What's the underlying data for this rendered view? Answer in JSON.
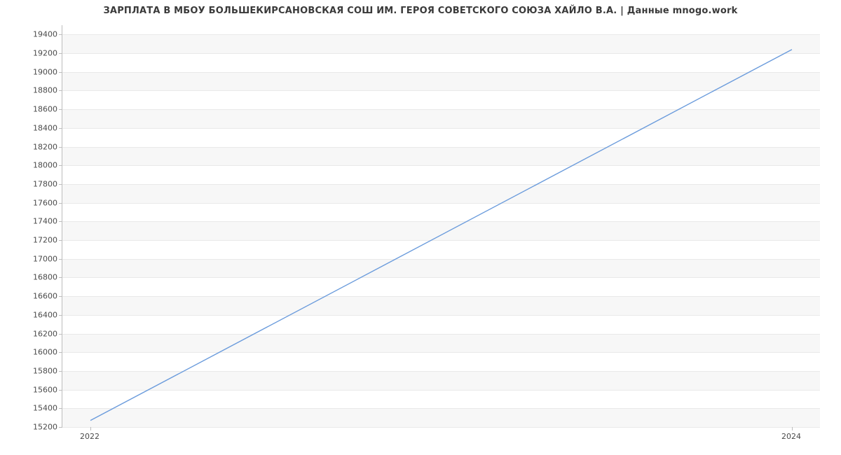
{
  "chart_data": {
    "type": "line",
    "title": "ЗАРПЛАТА В МБОУ БОЛЬШЕКИРСАНОВСКАЯ СОШ ИМ. ГЕРОЯ СОВЕТСКОГО СОЮЗА ХАЙЛО В.А. | Данные mnogo.work",
    "x": [
      2022,
      2024
    ],
    "values": [
      15270,
      19240
    ],
    "xlabel": "",
    "ylabel": "",
    "ylim": [
      15200,
      19500
    ],
    "xlim": [
      2021.92,
      2024.08
    ],
    "x_ticks": [
      2022,
      2024
    ],
    "y_ticks": [
      15200,
      15400,
      15600,
      15800,
      16000,
      16200,
      16400,
      16600,
      16800,
      17000,
      17200,
      17400,
      17600,
      17800,
      18000,
      18200,
      18400,
      18600,
      18800,
      19000,
      19200,
      19400
    ],
    "line_color": "#6a9bdc"
  }
}
